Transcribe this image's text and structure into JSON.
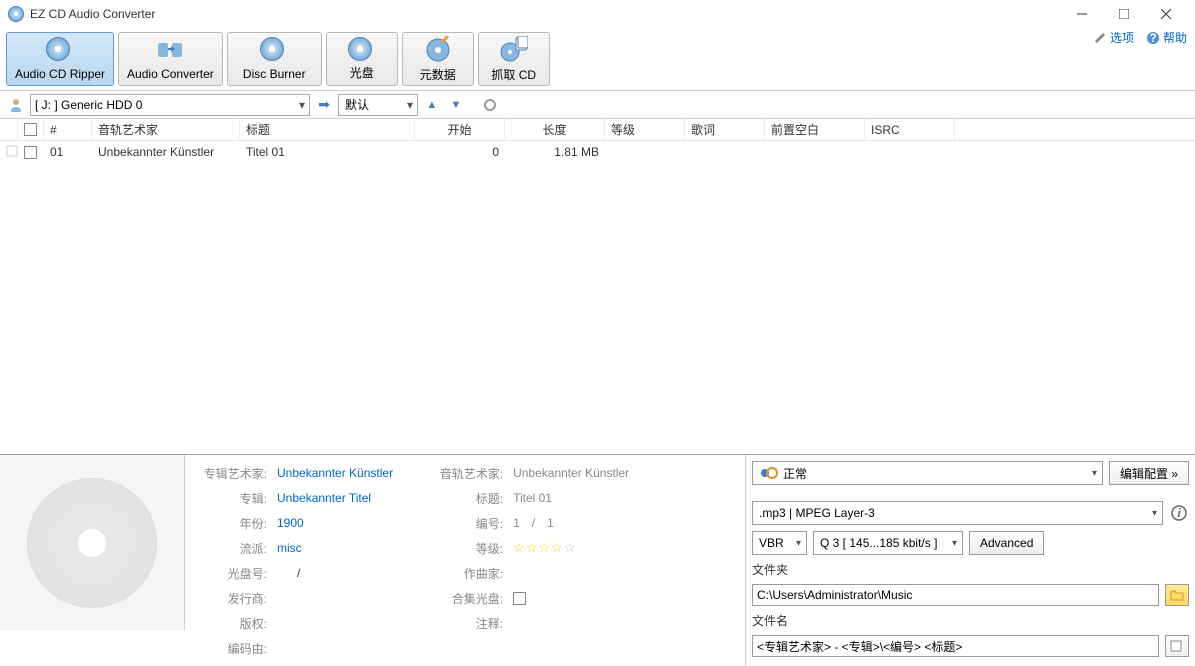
{
  "window": {
    "title": "EZ CD Audio Converter"
  },
  "toolbar": {
    "buttons": [
      {
        "label": "Audio CD Ripper"
      },
      {
        "label": "Audio Converter"
      },
      {
        "label": "Disc Burner"
      },
      {
        "label": "光盘"
      },
      {
        "label": "元数据"
      },
      {
        "label": "抓取 CD"
      }
    ]
  },
  "top_links": {
    "options": "选项",
    "help": "帮助"
  },
  "drivebar": {
    "drive": "[ J: ] Generic HDD 0",
    "mode": "默认"
  },
  "table": {
    "headers": {
      "num": "#",
      "artist": "音轨艺术家",
      "title": "标题",
      "start": "开始",
      "length": "长度",
      "rating": "等级",
      "lyrics": "歌词",
      "pregap": "前置空白",
      "isrc": "ISRC"
    },
    "rows": [
      {
        "num": "01",
        "artist": "Unbekannter Künstler",
        "title": "Titel 01",
        "start": "0",
        "length": "1.81 MB"
      }
    ]
  },
  "metadata": {
    "album_artist_label": "专辑艺术家:",
    "album_artist_value": "Unbekannter Künstler",
    "album_label": "专辑:",
    "album_value": "Unbekannter Titel",
    "year_label": "年份:",
    "year_value": "1900",
    "genre_label": "流派:",
    "genre_value": "misc",
    "disc_num_label": "光盘号:",
    "disc_num_value": "/",
    "publisher_label": "发行商:",
    "copyright_label": "版权:",
    "encoded_by_label": "编码由:",
    "track_artist_label": "音轨艺术家:",
    "track_artist_value": "Unbekannter Künstler",
    "track_title_label": "标题:",
    "track_title_value": "Titel 01",
    "track_num_label": "编号:",
    "track_num_value": "1",
    "track_num_sep": "/",
    "track_total": "1",
    "rating_label": "等级:",
    "composer_label": "作曲家:",
    "compilation_label": "合集光盘:",
    "notes_label": "注释:"
  },
  "output": {
    "profile": "正常",
    "edit_config": "编辑配置 »",
    "format": ".mp3 | MPEG Layer-3",
    "vbr": "VBR",
    "quality": "Q 3  [ 145...185 kbit/s ]",
    "advanced": "Advanced",
    "folder_label": "文件夹",
    "folder_path": "C:\\Users\\Administrator\\Music",
    "filename_label": "文件名",
    "filename_pattern": "<专辑艺术家> - <专辑>\\<编号> <标题>"
  }
}
